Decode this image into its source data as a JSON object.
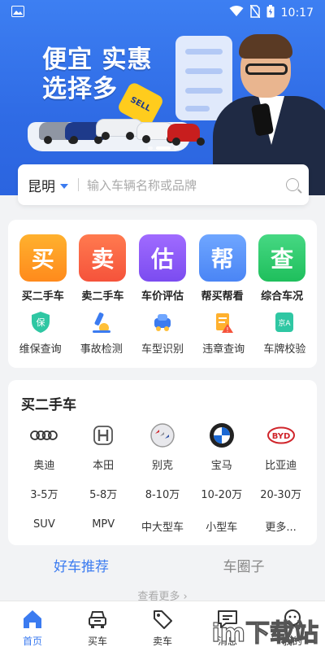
{
  "status_bar": {
    "time": "10:17",
    "battery_glyph": "battery-icon"
  },
  "banner": {
    "headline_line1": "便宜 实惠",
    "headline_line2": "选择多",
    "tag_text": "SELL",
    "slide_index": 2,
    "slide_count": 3
  },
  "search": {
    "city": "昆明",
    "placeholder": "输入车辆名称或品牌"
  },
  "services": {
    "primary": [
      {
        "glyph": "买",
        "label": "买二手车",
        "color_from": "#ffb12e",
        "color_to": "#ff8a1c"
      },
      {
        "glyph": "卖",
        "label": "卖二手车",
        "color_from": "#ff7a4f",
        "color_to": "#f5533b"
      },
      {
        "glyph": "估",
        "label": "车价评估",
        "color_from": "#a06bff",
        "color_to": "#7b4cf0"
      },
      {
        "glyph": "帮",
        "label": "帮买帮看",
        "color_from": "#6fa6ff",
        "color_to": "#4a85f5"
      },
      {
        "glyph": "查",
        "label": "综合车况",
        "color_from": "#46d883",
        "color_to": "#1fbf5c"
      }
    ],
    "secondary": [
      {
        "icon": "warranty-shield-icon",
        "label": "维保查询"
      },
      {
        "icon": "accident-check-icon",
        "label": "事故检测"
      },
      {
        "icon": "car-model-scan-icon",
        "label": "车型识别"
      },
      {
        "icon": "violation-doc-icon",
        "label": "违章查询"
      },
      {
        "icon": "plate-check-icon",
        "label": "车牌校验",
        "badge": "京A"
      }
    ]
  },
  "buy_section": {
    "title": "买二手车",
    "brands": [
      {
        "icon": "audi-logo-icon",
        "name": "奥迪"
      },
      {
        "icon": "honda-logo-icon",
        "name": "本田"
      },
      {
        "icon": "buick-logo-icon",
        "name": "别克"
      },
      {
        "icon": "bmw-logo-icon",
        "name": "宝马"
      },
      {
        "icon": "byd-logo-icon",
        "name": "比亚迪",
        "logo_text": "BYD"
      }
    ],
    "price_ranges": [
      "3-5万",
      "5-8万",
      "8-10万",
      "10-20万",
      "20-30万"
    ],
    "car_types": [
      "SUV",
      "MPV",
      "中大型车",
      "小型车",
      "更多..."
    ]
  },
  "feed_tabs": [
    {
      "label": "好车推荐",
      "active": true
    },
    {
      "label": "车圈子",
      "active": false
    }
  ],
  "more_link": "查看更多 ›",
  "bottom_nav": [
    {
      "icon": "home-icon",
      "label": "首页",
      "active": true
    },
    {
      "icon": "buy-car-icon",
      "label": "买车",
      "active": false
    },
    {
      "icon": "sell-tag-icon",
      "label": "卖车",
      "active": false
    },
    {
      "icon": "message-icon",
      "label": "消息",
      "active": false
    },
    {
      "icon": "profile-icon",
      "label": "我的",
      "active": false
    }
  ],
  "watermark": "im下载站",
  "colors": {
    "accent": "#3b7bf0",
    "banner": "#2f6be5",
    "page_bg": "#f2f3f5"
  }
}
